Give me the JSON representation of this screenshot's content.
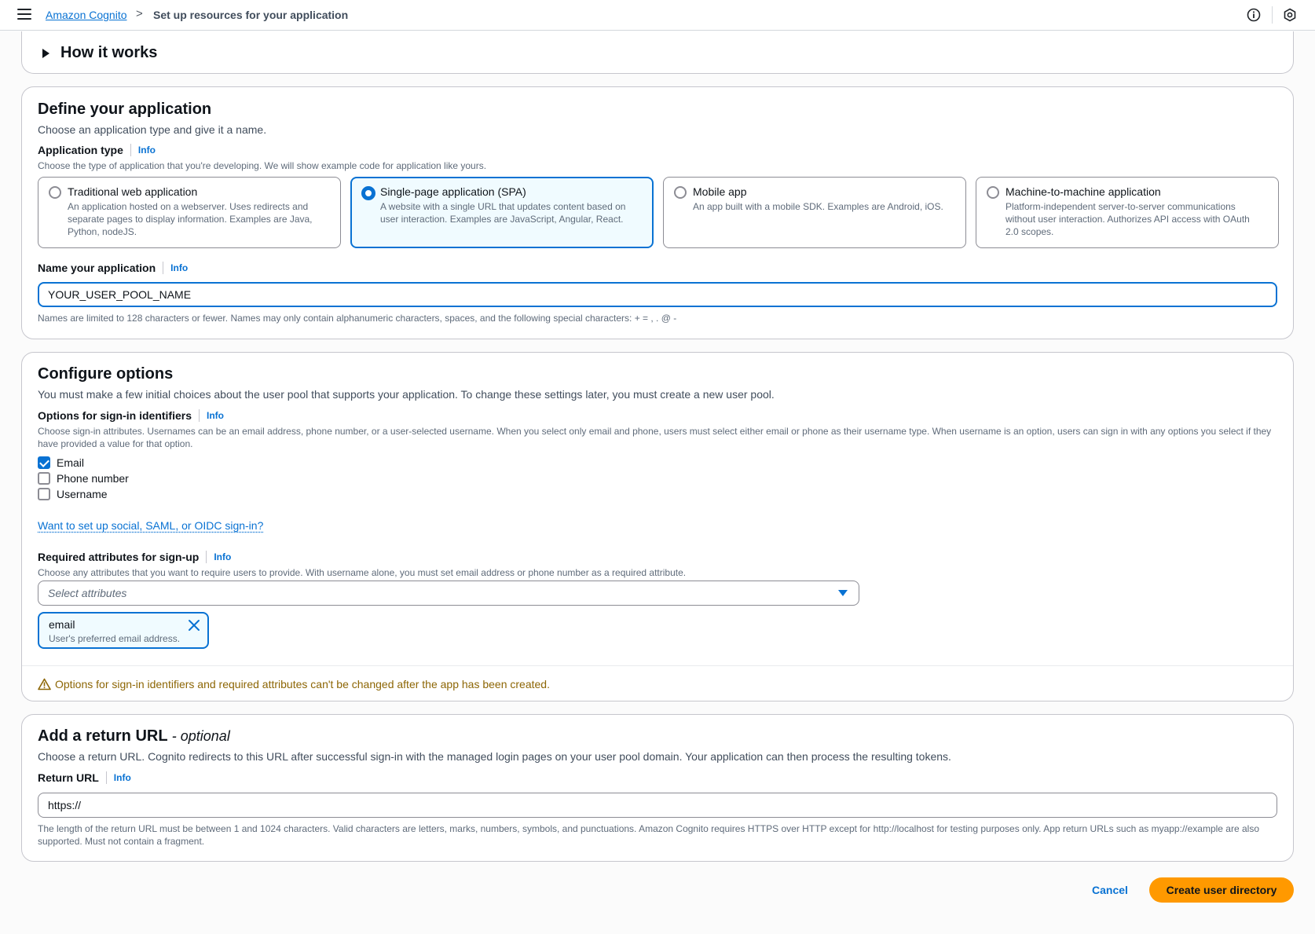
{
  "topbar": {
    "menu_icon": "hamburger-menu-icon",
    "breadcrumb_root": "Amazon Cognito",
    "breadcrumb_separator": ">",
    "breadcrumb_current": "Set up resources for your application",
    "info_icon": "info-circle-icon",
    "settings_icon": "hexagon-settings-icon"
  },
  "how_it_works": {
    "title": "How it works"
  },
  "define": {
    "title": "Define your application",
    "description": "Choose an application type and give it a name.",
    "app_type_label": "Application type",
    "info": "Info",
    "app_type_hint": "Choose the type of application that you're developing. We will show example code for application like yours.",
    "tiles": [
      {
        "title": "Traditional web application",
        "description": "An application hosted on a webserver. Uses redirects and separate pages to display information. Examples are Java, Python, nodeJS.",
        "selected": false
      },
      {
        "title": "Single-page application (SPA)",
        "description": "A website with a single URL that updates content based on user interaction. Examples are JavaScript, Angular, React.",
        "selected": true
      },
      {
        "title": "Mobile app",
        "description": "An app built with a mobile SDK. Examples are Android, iOS.",
        "selected": false
      },
      {
        "title": "Machine-to-machine application",
        "description": "Platform-independent server-to-server communications without user interaction. Authorizes API access with OAuth 2.0 scopes.",
        "selected": false
      }
    ],
    "name_label": "Name your application",
    "name_value": "YOUR_USER_POOL_NAME",
    "name_hint": "Names are limited to 128 characters or fewer. Names may only contain alphanumeric characters, spaces, and the following special characters: + = , . @ -"
  },
  "configure": {
    "title": "Configure options",
    "description": "You must make a few initial choices about the user pool that supports your application. To change these settings later, you must create a new user pool.",
    "signin_label": "Options for sign-in identifiers",
    "info": "Info",
    "signin_hint": "Choose sign-in attributes. Usernames can be an email address, phone number, or a user-selected username. When you select only email and phone, users must select either email or phone as their username type. When username is an option, users can sign in with any options you select if they have provided a value for that option.",
    "identifiers": [
      {
        "label": "Email",
        "checked": true
      },
      {
        "label": "Phone number",
        "checked": false
      },
      {
        "label": "Username",
        "checked": false
      }
    ],
    "social_link": "Want to set up social, SAML, or OIDC sign-in?",
    "required_label": "Required attributes for sign-up",
    "required_hint": "Choose any attributes that you want to require users to provide. With username alone, you must set email address or phone number as a required attribute.",
    "select_placeholder": "Select attributes",
    "token_name": "email",
    "token_desc": "User's preferred email address.",
    "warning": "Options for sign-in identifiers and required attributes can't be changed after the app has been created."
  },
  "return_url": {
    "title": "Add a return URL",
    "optional": "- optional",
    "description": "Choose a return URL. Cognito redirects to this URL after successful sign-in with the managed login pages on your user pool domain. Your application can then process the resulting tokens.",
    "label": "Return URL",
    "info": "Info",
    "value": "https://",
    "hint": "The length of the return URL must be between 1 and 1024 characters. Valid characters are letters, marks, numbers, symbols, and punctuations. Amazon Cognito requires HTTPS over HTTP except for http://localhost for testing purposes only. App return URLs such as myapp://example are also supported. Must not contain a fragment."
  },
  "footer": {
    "cancel": "Cancel",
    "create": "Create user directory"
  },
  "colors": {
    "accent": "#0972d3",
    "primary_button": "#ff9900",
    "warning": "#8d6605"
  }
}
